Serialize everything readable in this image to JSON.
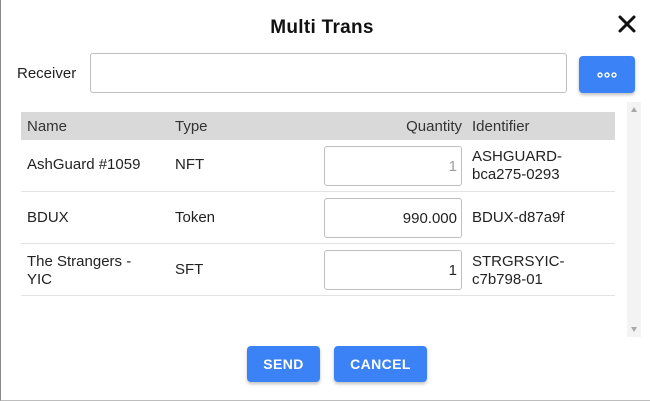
{
  "dialog": {
    "title": "Multi Trans"
  },
  "receiver": {
    "label": "Receiver",
    "value": "",
    "placeholder": ""
  },
  "table": {
    "headers": {
      "name": "Name",
      "type": "Type",
      "quantity": "Quantity",
      "identifier": "Identifier"
    },
    "rows": [
      {
        "name": "AshGuard #1059",
        "type": "NFT",
        "quantity": "1",
        "identifier": "ASHGUARD-bca275-0293",
        "quantity_editable": false
      },
      {
        "name": "BDUX",
        "type": "Token",
        "quantity": "990.000",
        "identifier": "BDUX-d87a9f",
        "quantity_editable": true
      },
      {
        "name": "The Strangers - YIC",
        "type": "SFT",
        "quantity": "1",
        "identifier": "STRGRSYIC-c7b798-01",
        "quantity_editable": true
      }
    ]
  },
  "actions": {
    "send_label": "SEND",
    "cancel_label": "CANCEL"
  },
  "colors": {
    "accent": "#3b82f6",
    "header_bg": "#d9d9d9"
  },
  "icons": {
    "close": "close-icon",
    "more": "ellipsis-icon"
  }
}
